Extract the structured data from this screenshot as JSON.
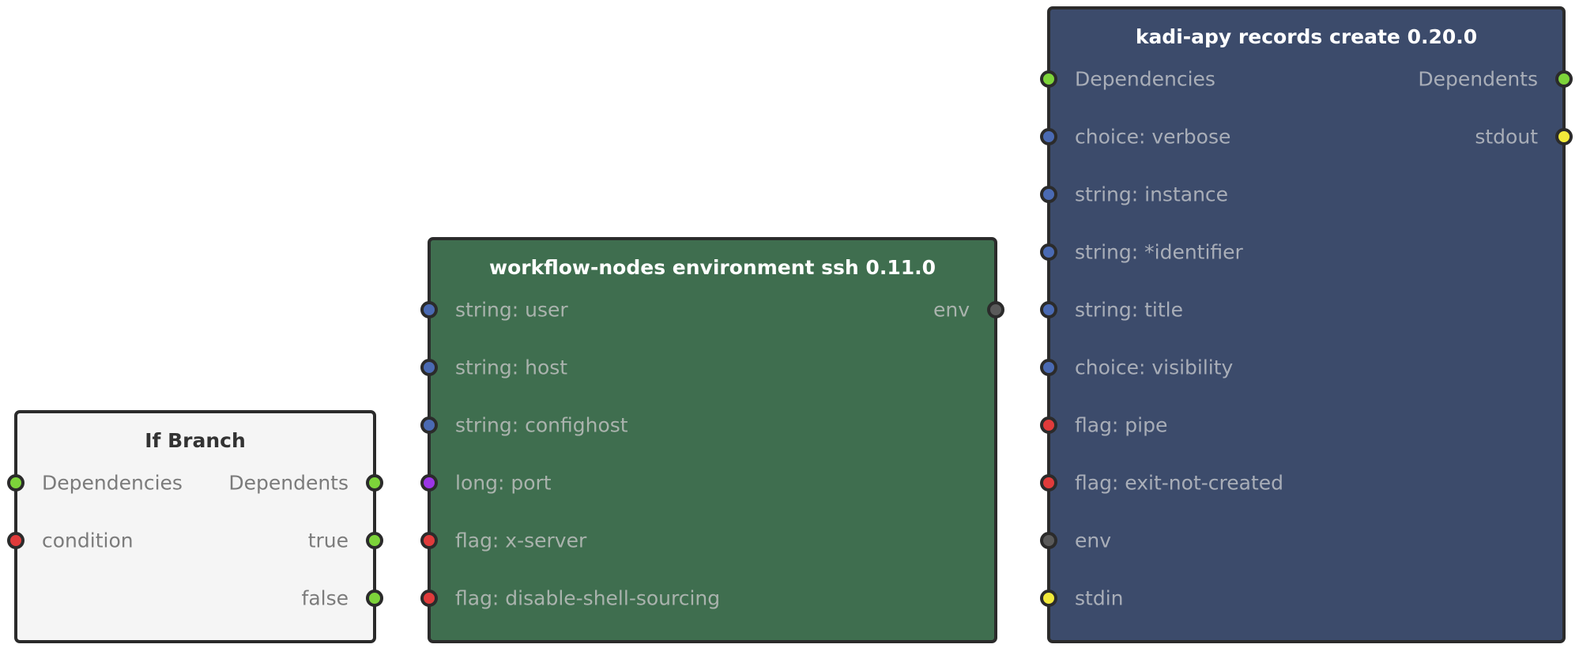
{
  "port_colors": {
    "dependency": "#7dd43a",
    "string": "#4a6ab3",
    "flag": "#e03b3b",
    "long": "#9b35e6",
    "env": "#5a5a5a",
    "pipe": "#f2ea3a"
  },
  "nodes": [
    {
      "id": "node-if",
      "name": "if-branch-node",
      "title": "If Branch",
      "inputs": [
        {
          "label": "Dependencies",
          "type": "dependency"
        },
        {
          "label": "condition",
          "type": "flag"
        }
      ],
      "outputs": [
        {
          "label": "Dependents",
          "type": "dependency"
        },
        {
          "label": "true",
          "type": "dependency"
        },
        {
          "label": "false",
          "type": "dependency"
        }
      ]
    },
    {
      "id": "node-ssh",
      "name": "ssh-environment-node",
      "title": "workflow-nodes environment ssh 0.11.0",
      "inputs": [
        {
          "label": "string: user",
          "type": "string"
        },
        {
          "label": "string: host",
          "type": "string"
        },
        {
          "label": "string: confighost",
          "type": "string"
        },
        {
          "label": "long: port",
          "type": "long"
        },
        {
          "label": "flag: x-server",
          "type": "flag"
        },
        {
          "label": "flag: disable-shell-sourcing",
          "type": "flag"
        }
      ],
      "outputs": [
        {
          "label": "env",
          "type": "env"
        }
      ]
    },
    {
      "id": "node-kadi",
      "name": "kadi-records-create-node",
      "title": "kadi-apy records create 0.20.0",
      "inputs": [
        {
          "label": "Dependencies",
          "type": "dependency"
        },
        {
          "label": "choice: verbose",
          "type": "string"
        },
        {
          "label": "string: instance",
          "type": "string"
        },
        {
          "label": "string: *identifier",
          "type": "string"
        },
        {
          "label": "string: title",
          "type": "string"
        },
        {
          "label": "choice: visibility",
          "type": "string"
        },
        {
          "label": "flag: pipe",
          "type": "flag"
        },
        {
          "label": "flag: exit-not-created",
          "type": "flag"
        },
        {
          "label": "env",
          "type": "env"
        },
        {
          "label": "stdin",
          "type": "pipe"
        }
      ],
      "outputs": [
        {
          "label": "Dependents",
          "type": "dependency"
        },
        {
          "label": "stdout",
          "type": "pipe"
        }
      ]
    }
  ]
}
